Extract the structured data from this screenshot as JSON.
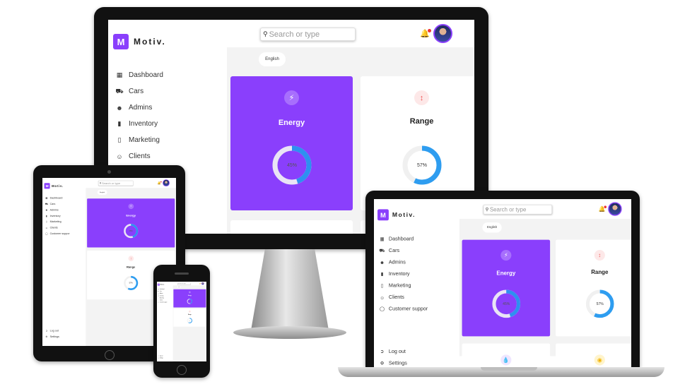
{
  "app": {
    "brand": "Motiv.",
    "logo_letter": "M",
    "accent_color": "#8a3ffc",
    "search_placeholder": "Search or type",
    "language": "English",
    "menu": [
      {
        "label": "Dashboard",
        "icon": "dashboard-icon"
      },
      {
        "label": "Cars",
        "icon": "car-icon"
      },
      {
        "label": "Admins",
        "icon": "admins-icon"
      },
      {
        "label": "Inventory",
        "icon": "inventory-icon"
      },
      {
        "label": "Marketing",
        "icon": "marketing-icon"
      },
      {
        "label": "Clients",
        "icon": "clients-icon"
      },
      {
        "label": "Customer suppor",
        "icon": "support-icon"
      }
    ],
    "bottom_menu": [
      {
        "label": "Log out",
        "icon": "logout-icon"
      },
      {
        "label": "Settings",
        "icon": "settings-icon"
      }
    ],
    "cards": [
      {
        "title": "Energy",
        "icon": "lightning-icon",
        "value_label": "45%",
        "value": 45,
        "color": "#2e90f0"
      },
      {
        "title": "Range",
        "icon": "range-arrows-icon",
        "value_label": "57%",
        "value": 57,
        "color": "#2e9df0"
      },
      {
        "title": "",
        "icon": "drop-icon"
      },
      {
        "title": "",
        "icon": "coin-icon"
      }
    ]
  }
}
